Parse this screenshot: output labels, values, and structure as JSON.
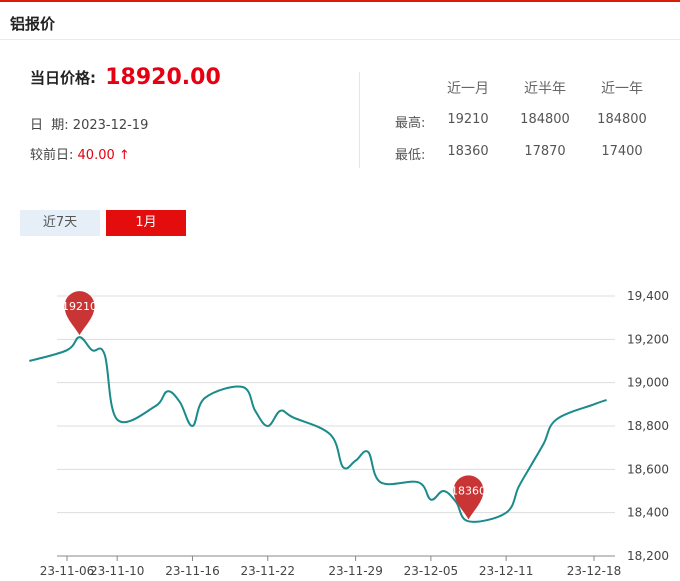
{
  "header": {
    "title": "铝报价"
  },
  "summary": {
    "price_label": "当日价格:",
    "price": "18920.00",
    "date_label": "日  期:",
    "date": "2023-12-19",
    "change_label": "较前日:",
    "change": "40.00 ↑"
  },
  "stats": {
    "columns": [
      "近一月",
      "近半年",
      "近一年"
    ],
    "rows": [
      {
        "label": "最高:",
        "values": [
          "19210",
          "184800",
          "184800"
        ]
      },
      {
        "label": "最低:",
        "values": [
          "18360",
          "17870",
          "17400"
        ]
      }
    ]
  },
  "tabs": [
    {
      "label": "近7天",
      "active": false
    },
    {
      "label": "1月",
      "active": true
    }
  ],
  "colors": {
    "accent": "#e30d0d",
    "line": "#1a8a8a",
    "marker": "#c93535",
    "grid": "#dddddd"
  },
  "chart_data": {
    "type": "line",
    "x_ticks": [
      "23-11-06",
      "23-11-10",
      "23-11-16",
      "23-11-22",
      "23-11-29",
      "23-12-05",
      "23-12-11",
      "23-12-18"
    ],
    "y_ticks": [
      "19,400",
      "19,200",
      "19,000",
      "18,800",
      "18,600",
      "18,400",
      "18,200"
    ],
    "ylim": [
      18200,
      19400
    ],
    "grid": true,
    "y_axis_side": "right",
    "series": [
      {
        "x": [
          "2023-11-03",
          "2023-11-06",
          "2023-11-07",
          "2023-11-08",
          "2023-11-09",
          "2023-11-10",
          "2023-11-13",
          "2023-11-14",
          "2023-11-15",
          "2023-11-16",
          "2023-11-17",
          "2023-11-20",
          "2023-11-21",
          "2023-11-22",
          "2023-11-23",
          "2023-11-24",
          "2023-11-27",
          "2023-11-28",
          "2023-11-29",
          "2023-11-30",
          "2023-12-01",
          "2023-12-04",
          "2023-12-05",
          "2023-12-06",
          "2023-12-07",
          "2023-12-08",
          "2023-12-11",
          "2023-12-12",
          "2023-12-13",
          "2023-12-14",
          "2023-12-15",
          "2023-12-18",
          "2023-12-19"
        ],
        "values": [
          19100,
          19150,
          19210,
          19150,
          19130,
          18830,
          18890,
          18960,
          18910,
          18800,
          18930,
          18980,
          18870,
          18800,
          18870,
          18840,
          18760,
          18610,
          18640,
          18680,
          18540,
          18540,
          18460,
          18500,
          18450,
          18360,
          18400,
          18520,
          18620,
          18720,
          18830,
          18900,
          18920
        ]
      }
    ],
    "markers": [
      {
        "label": "19210",
        "x": "2023-11-07",
        "y": 19210
      },
      {
        "label": "18360",
        "x": "2023-12-08",
        "y": 18360
      }
    ]
  }
}
